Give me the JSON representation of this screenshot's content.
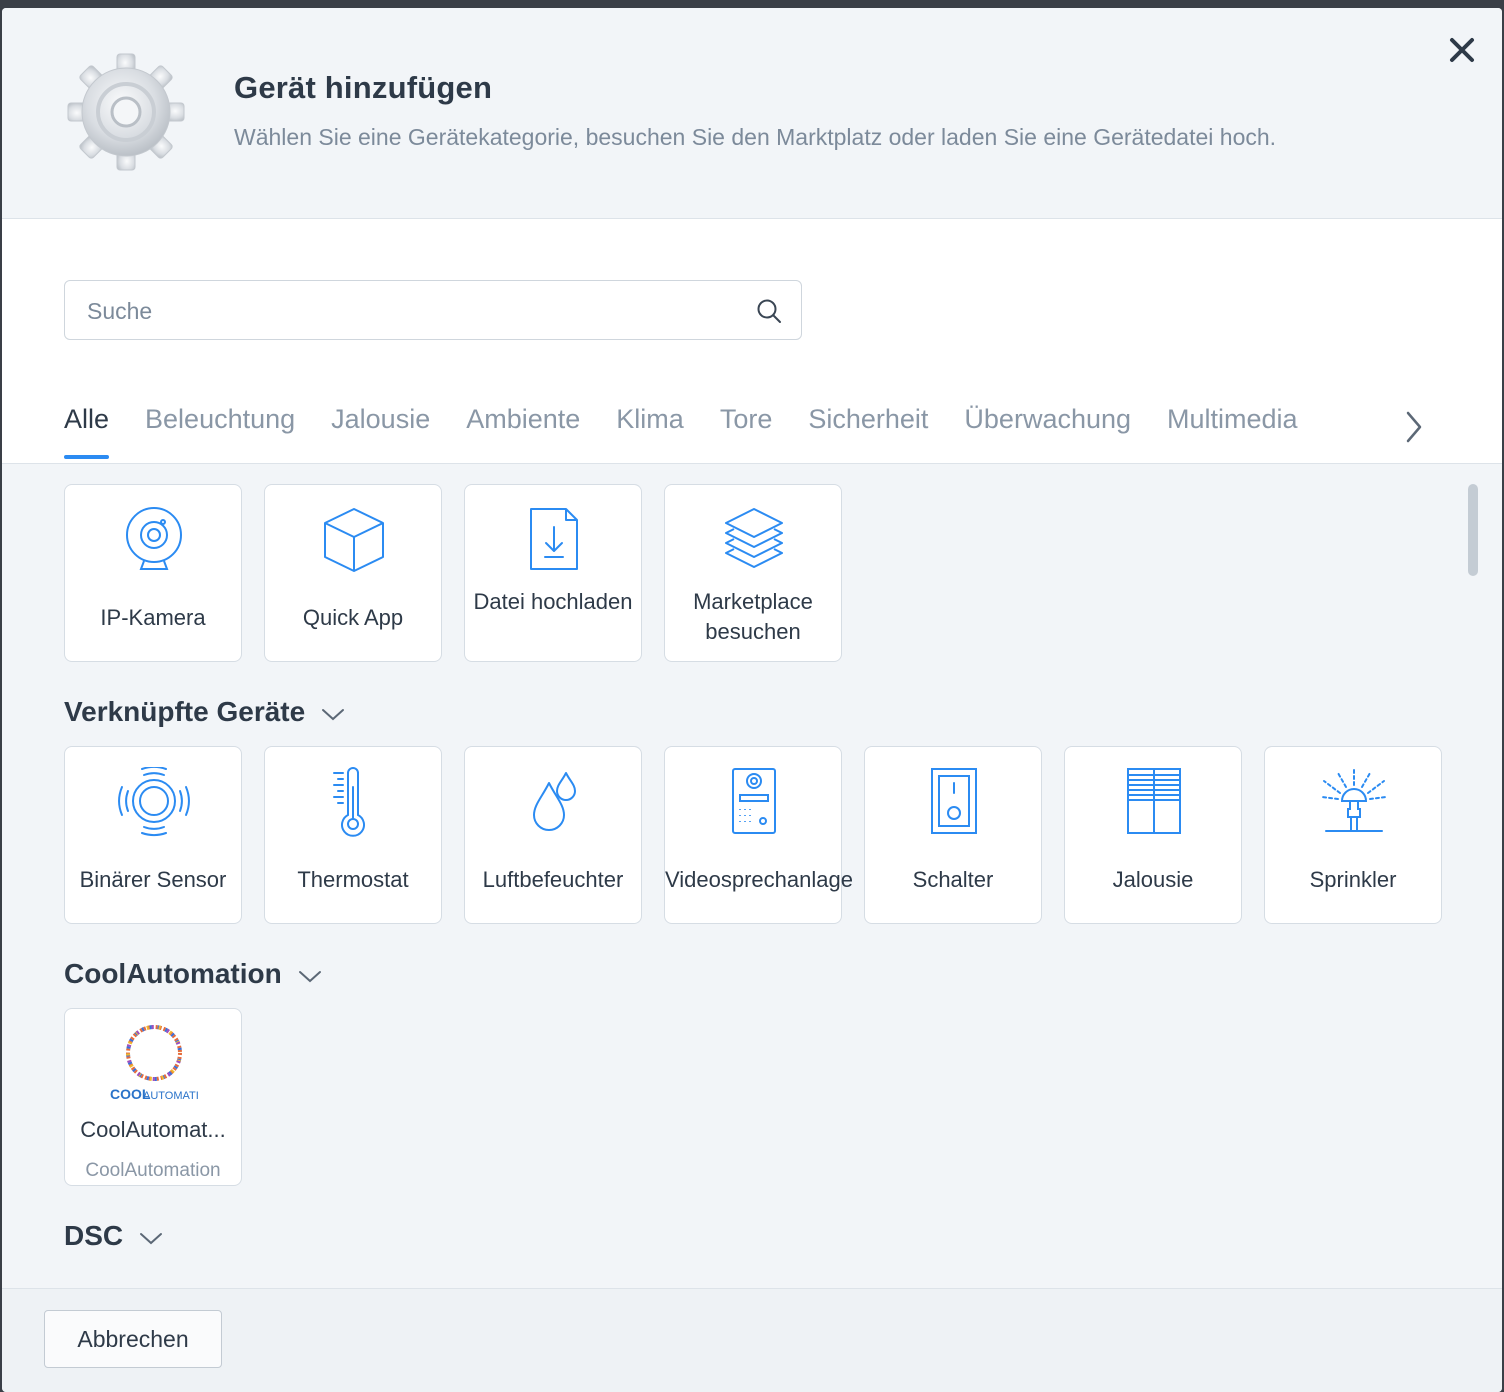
{
  "dialog": {
    "title": "Gerät hinzufügen",
    "subtitle": "Wählen Sie eine Gerätekategorie, besuchen Sie den Marktplatz oder laden Sie eine Gerätedatei hoch."
  },
  "search": {
    "placeholder": "Suche",
    "value": ""
  },
  "tabs": [
    "Alle",
    "Beleuchtung",
    "Jalousie",
    "Ambiente",
    "Klima",
    "Tore",
    "Sicherheit",
    "Überwachung",
    "Multimedia"
  ],
  "active_tab": "Alle",
  "quick_actions": [
    {
      "label": "IP-Kamera",
      "icon": "camera-icon"
    },
    {
      "label": "Quick App",
      "icon": "cube-icon"
    },
    {
      "label": "Datei hochladen",
      "icon": "file-download-icon"
    },
    {
      "label": "Marketplace besuchen",
      "icon": "layers-icon"
    }
  ],
  "sections": [
    {
      "title": "Verknüpfte Geräte",
      "items": [
        {
          "label": "Binärer Sensor",
          "icon": "binary-sensor-icon"
        },
        {
          "label": "Thermostat",
          "icon": "thermometer-icon"
        },
        {
          "label": "Luftbefeuchter",
          "icon": "water-drops-icon"
        },
        {
          "label": "Videosprechanlage",
          "icon": "intercom-icon"
        },
        {
          "label": "Schalter",
          "icon": "switch-icon"
        },
        {
          "label": "Jalousie",
          "icon": "blinds-icon"
        },
        {
          "label": "Sprinkler",
          "icon": "sprinkler-icon"
        }
      ]
    },
    {
      "title": "CoolAutomation",
      "items": [
        {
          "label": "CoolAutomat...",
          "sublabel": "CoolAutomation",
          "logo_text_a": "COOL",
          "logo_text_b": "AUTOMATION",
          "icon": "coolautomation-logo"
        }
      ]
    },
    {
      "title": "DSC",
      "items": []
    }
  ],
  "footer": {
    "cancel_label": "Abbrechen"
  },
  "colors": {
    "accent": "#2b8bf2",
    "text": "#2e3a48",
    "muted": "#7c8a9a"
  }
}
